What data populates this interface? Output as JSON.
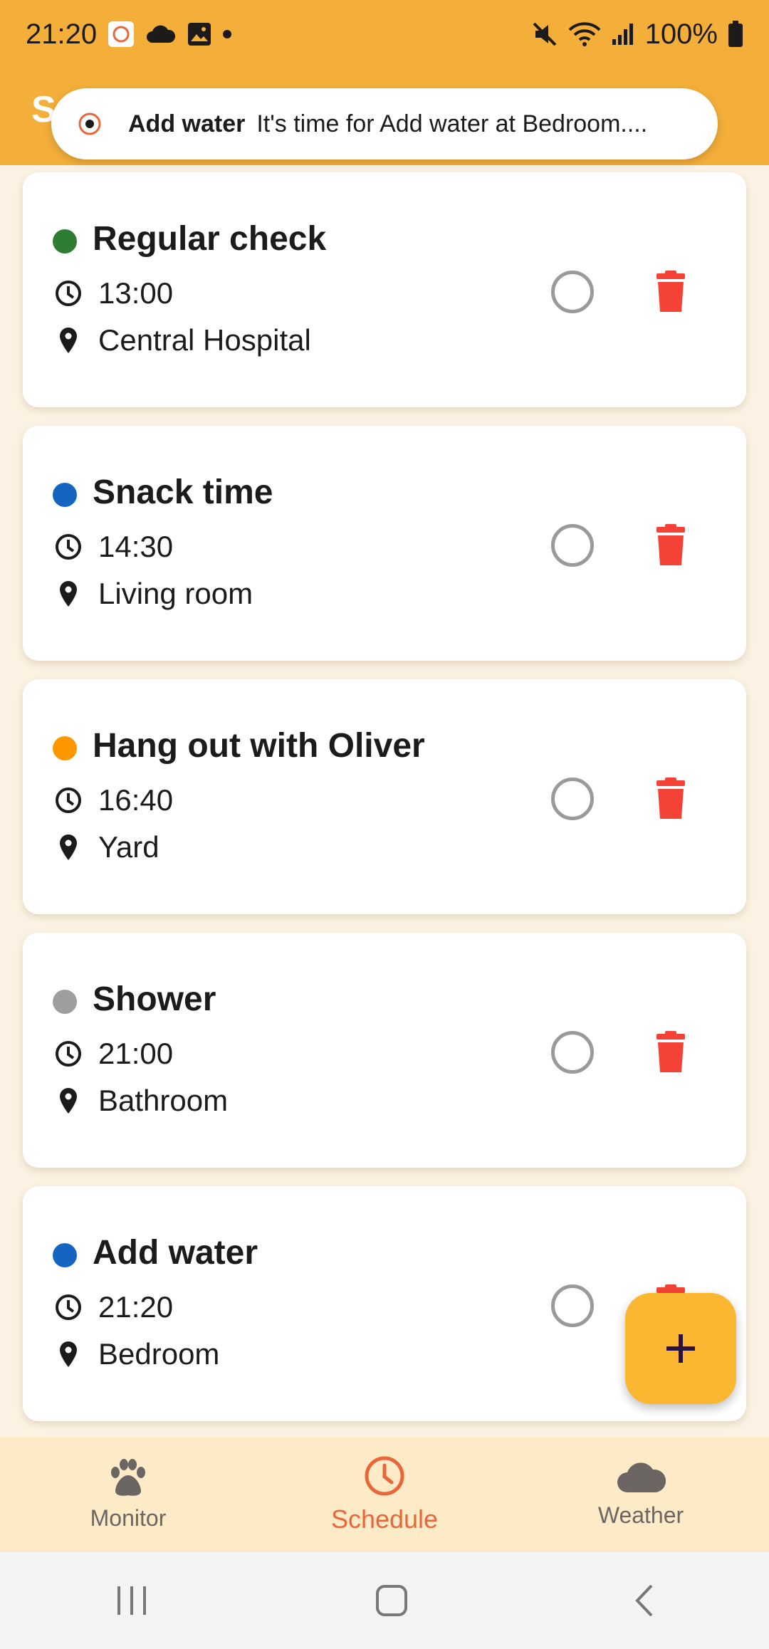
{
  "status_bar": {
    "time": "21:20",
    "battery": "100%"
  },
  "app_bar": {
    "title": "S"
  },
  "notification": {
    "title": "Add water",
    "text": "It's time for Add water at Bedroom...."
  },
  "tasks": [
    {
      "title": "Regular check",
      "time": "13:00",
      "location": "Central Hospital",
      "color": "#2E7D32"
    },
    {
      "title": "Snack time",
      "time": "14:30",
      "location": "Living room",
      "color": "#1565C0"
    },
    {
      "title": "Hang out with Oliver",
      "time": "16:40",
      "location": "Yard",
      "color": "#FF9800"
    },
    {
      "title": "Shower",
      "time": "21:00",
      "location": "Bathroom",
      "color": "#9E9E9E"
    },
    {
      "title": "Add water",
      "time": "21:20",
      "location": "Bedroom",
      "color": "#1565C0"
    }
  ],
  "fab": {
    "icon": "plus-icon"
  },
  "bottom_nav": [
    {
      "label": "Monitor",
      "icon": "paw-icon",
      "active": false
    },
    {
      "label": "Schedule",
      "icon": "clock-icon",
      "active": true
    },
    {
      "label": "Weather",
      "icon": "cloud-icon",
      "active": false
    }
  ],
  "colors": {
    "accent": "#F4AF3A",
    "active_nav": "#E8673A",
    "delete": "#F44336",
    "fab": "#FBB731"
  }
}
